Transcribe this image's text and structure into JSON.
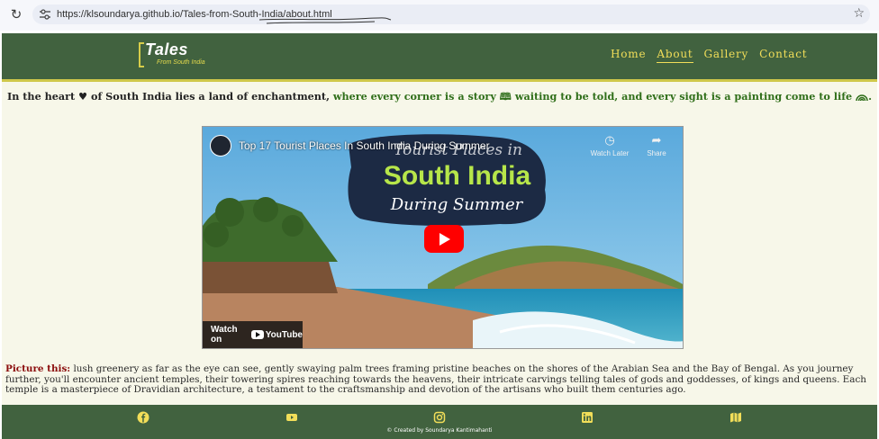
{
  "browser": {
    "url": "https://klsoundarya.github.io/Tales-from-South-India/about.html"
  },
  "logo": {
    "title": "Tales",
    "subtitle": "From South India"
  },
  "nav": [
    {
      "label": "Home",
      "active": false
    },
    {
      "label": "About",
      "active": true
    },
    {
      "label": "Gallery",
      "active": false
    },
    {
      "label": "Contact",
      "active": false
    }
  ],
  "tagline": {
    "part1": "In the heart",
    "heart_icon": "heart-icon",
    "part2": "of South India lies a land of enchantment,",
    "part3": "where every corner is a story",
    "book_icon": "book-icon",
    "part4": "waiting to be told, and every sight is a painting come to life",
    "rainbow_icon": "rainbow-icon",
    "part5": "."
  },
  "video": {
    "title": "Top 17 Tourist Places In South India During Summer",
    "banner_line1": "Tourist Places in",
    "banner_line2": "South India",
    "banner_line3": "During Summer",
    "watch_later": "Watch Later",
    "share": "Share",
    "watch_on": "Watch on",
    "youtube": "YouTube"
  },
  "paragraph": {
    "lead": "Picture this:",
    "body": " lush greenery as far as the eye can see, gently swaying palm trees framing pristine beaches on the shores of the Arabian Sea and the Bay of Bengal. As you journey further, you'll encounter ancient temples, their towering spires reaching towards the heavens, their intricate carvings telling tales of gods and goddesses, of kings and queens. Each temple is a masterpiece of Dravidian architecture, a testament to the craftsmanship and devotion of the artisans who built them centuries ago."
  },
  "footer": {
    "icons": [
      "facebook-icon",
      "youtube-icon",
      "instagram-icon",
      "linkedin-icon",
      "map-icon"
    ],
    "credit": "© Created by Soundarya Kantimahanti"
  },
  "colors": {
    "nav_bg": "#41623f",
    "nav_link": "#f2de59",
    "page_bg": "#f7f7e9",
    "tagline_green": "#2f6e19",
    "lead_red": "#8b0d0d"
  }
}
